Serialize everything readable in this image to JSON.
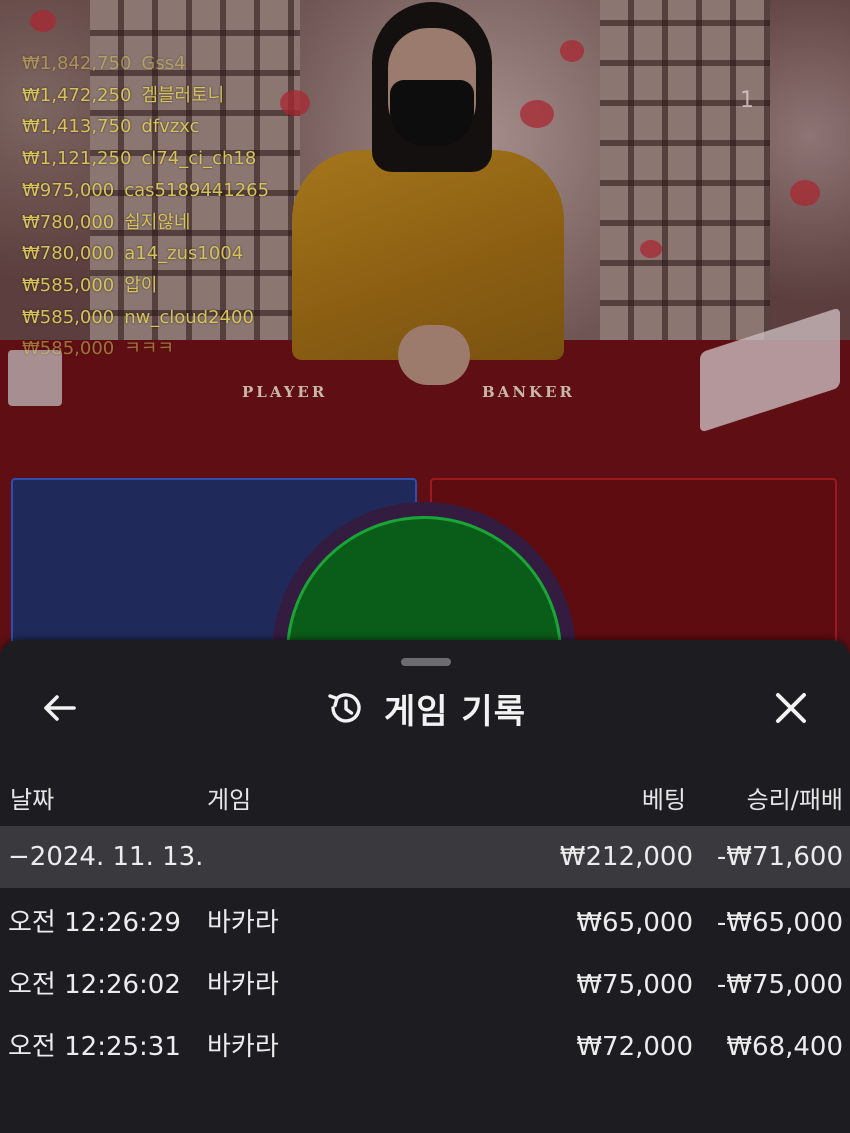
{
  "stream": {
    "viewer_count": "1",
    "table_labels": {
      "player": "PLAYER",
      "banker": "BANKER"
    },
    "ranking": [
      {
        "amount": "₩1,842,750",
        "name": "Gss4"
      },
      {
        "amount": "₩1,472,250",
        "name": "겜블러토니"
      },
      {
        "amount": "₩1,413,750",
        "name": "dfvzxc"
      },
      {
        "amount": "₩1,121,250",
        "name": "cl74_ci_ch18"
      },
      {
        "amount": "₩975,000",
        "name": "cas5189441265"
      },
      {
        "amount": "₩780,000",
        "name": "쉽지않네"
      },
      {
        "amount": "₩780,000",
        "name": "a14_zus1004"
      },
      {
        "amount": "₩585,000",
        "name": "압이"
      },
      {
        "amount": "₩585,000",
        "name": "nw_cloud2400"
      },
      {
        "amount": "₩585,000",
        "name": "ㅋㅋㅋ"
      }
    ]
  },
  "sheet": {
    "title": "게임 기록",
    "back_icon": "arrow-left-icon",
    "close_icon": "close-icon",
    "title_icon": "history-icon",
    "columns": {
      "date": "날짜",
      "game": "게임",
      "bet": "베팅",
      "result": "승리/패배"
    },
    "summary": {
      "date": "−2024. 11. 13.",
      "bet": "₩212,000",
      "result": "-₩71,600"
    },
    "rows": [
      {
        "time": "오전 12:26:29",
        "game": "바카라",
        "bet": "₩65,000",
        "result": "-₩65,000"
      },
      {
        "time": "오전 12:26:02",
        "game": "바카라",
        "bet": "₩75,000",
        "result": "-₩75,000"
      },
      {
        "time": "오전 12:25:31",
        "game": "바카라",
        "bet": "₩72,000",
        "result": "₩68,400"
      }
    ]
  },
  "colors": {
    "sheet_bg": "#1d1d21",
    "summary_bg": "#3a3a3e",
    "ranking_text": "#d8c25a",
    "player_area": "#1f2a5a",
    "banker_area": "#5e0c10",
    "tie_area": "#0a5d18"
  }
}
